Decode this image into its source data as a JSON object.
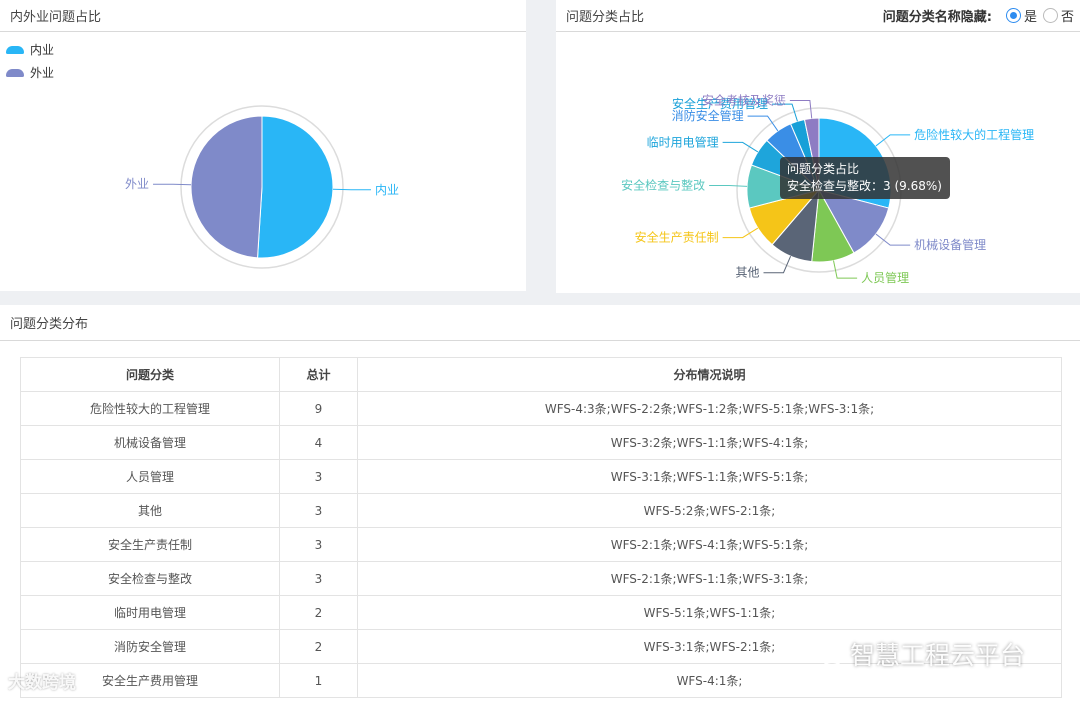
{
  "panel_inout": {
    "title": "内外业问题占比",
    "legend": [
      {
        "label": "内业",
        "color": "#29b6f6"
      },
      {
        "label": "外业",
        "color": "#7f8ac9"
      }
    ],
    "slice_labels": {
      "inner": "内业",
      "outer": "外业"
    }
  },
  "panel_category": {
    "title": "问题分类占比",
    "toggle_label": "问题分类名称隐藏:",
    "toggle_options": {
      "yes": "是",
      "no": "否"
    },
    "toggle_selected": "是",
    "tooltip": {
      "title": "问题分类占比",
      "line": "安全检查与整改：3 (9.68%)"
    }
  },
  "panel_table": {
    "title": "问题分类分布",
    "headers": {
      "category": "问题分类",
      "total": "总计",
      "detail": "分布情况说明"
    },
    "rows": [
      {
        "category": "危险性较大的工程管理",
        "total": "9",
        "detail": "WFS-4:3条;WFS-2:2条;WFS-1:2条;WFS-5:1条;WFS-3:1条;"
      },
      {
        "category": "机械设备管理",
        "total": "4",
        "detail": "WFS-3:2条;WFS-1:1条;WFS-4:1条;"
      },
      {
        "category": "人员管理",
        "total": "3",
        "detail": "WFS-3:1条;WFS-1:1条;WFS-5:1条;"
      },
      {
        "category": "其他",
        "total": "3",
        "detail": "WFS-5:2条;WFS-2:1条;"
      },
      {
        "category": "安全生产责任制",
        "total": "3",
        "detail": "WFS-2:1条;WFS-4:1条;WFS-5:1条;"
      },
      {
        "category": "安全检查与整改",
        "total": "3",
        "detail": "WFS-2:1条;WFS-1:1条;WFS-3:1条;"
      },
      {
        "category": "临时用电管理",
        "total": "2",
        "detail": "WFS-5:1条;WFS-1:1条;"
      },
      {
        "category": "消防安全管理",
        "total": "2",
        "detail": "WFS-3:1条;WFS-2:1条;"
      },
      {
        "category": "安全生产费用管理",
        "total": "1",
        "detail": "WFS-4:1条;"
      }
    ]
  },
  "watermarks": {
    "left": "大数跨境",
    "right": "智慧工程云平台"
  },
  "chart_data": [
    {
      "type": "pie",
      "title": "内外业问题占比",
      "categories": [
        "内业",
        "外业"
      ],
      "values": [
        51,
        49
      ],
      "colors": [
        "#29b6f6",
        "#7f8ac9"
      ],
      "legend": "top-left"
    },
    {
      "type": "pie",
      "title": "问题分类占比",
      "categories": [
        "危险性较大的工程管理",
        "机械设备管理",
        "人员管理",
        "其他",
        "安全生产责任制",
        "安全检查与整改",
        "临时用电管理",
        "消防安全管理",
        "安全生产费用管理",
        "安全考核及奖惩"
      ],
      "values": [
        9,
        4,
        3,
        3,
        3,
        3,
        2,
        2,
        1,
        1
      ],
      "colors": [
        "#29b6f6",
        "#7f8ac9",
        "#7ec855",
        "#5a6577",
        "#f5c518",
        "#5bc8c0",
        "#1ea5db",
        "#3a8ee6",
        "#18a0d8",
        "#8e7cc3"
      ]
    }
  ]
}
